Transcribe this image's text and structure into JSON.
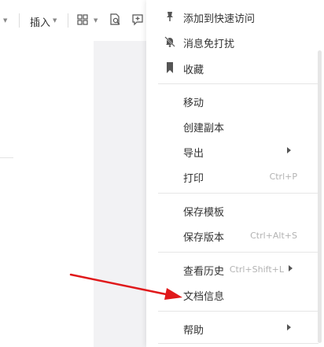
{
  "toolbar": {
    "insert_label": "插入",
    "icons": [
      "dropdown-caret",
      "grid-view-icon",
      "find-doc-icon",
      "add-comment-icon"
    ]
  },
  "menu": {
    "items": [
      {
        "label": "添加到快速访问",
        "icon": "pin-icon"
      },
      {
        "label": "消息免打扰",
        "icon": "bell-off-icon"
      },
      {
        "label": "收藏",
        "icon": "bookmark-icon"
      },
      {
        "label": "移动"
      },
      {
        "label": "创建副本"
      },
      {
        "label": "导出",
        "has_submenu": true
      },
      {
        "label": "打印",
        "shortcut": "Ctrl+P"
      },
      {
        "label": "保存模板"
      },
      {
        "label": "保存版本",
        "shortcut": "Ctrl+Alt+S"
      },
      {
        "label": "查看历史",
        "shortcut": "Ctrl+Shift+L",
        "has_submenu": true
      },
      {
        "label": "文档信息"
      },
      {
        "label": "帮助",
        "has_submenu": true
      }
    ]
  },
  "colors": {
    "annotation_arrow": "#e0191b",
    "menu_text": "#333333",
    "shortcut_text": "#b3b3b3",
    "canvas_bg": "#f2f2f4"
  }
}
